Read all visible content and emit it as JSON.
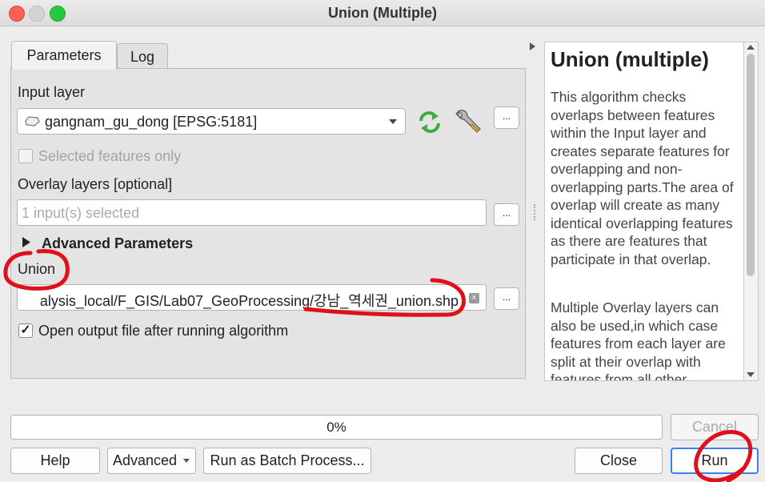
{
  "window": {
    "title": "Union (Multiple)"
  },
  "tabs": [
    {
      "label": "Parameters"
    },
    {
      "label": "Log"
    }
  ],
  "form": {
    "input_layer_label": "Input layer",
    "input_layer_value": "gangnam_gu_dong [EPSG:5181]",
    "selected_only_label": "Selected features only",
    "overlay_label": "Overlay layers [optional]",
    "overlay_placeholder": "1 input(s) selected",
    "advanced_label": "Advanced Parameters",
    "union_label": "Union",
    "union_value": "alysis_local/F_GIS/Lab07_GeoProcessing/강남_역세권_union.shp",
    "open_output_label": "Open output file after running algorithm",
    "open_output_checked": true,
    "ellipsis": "..."
  },
  "help_panel": {
    "title": "Union (multiple)",
    "paragraph1": "This algorithm checks overlaps between features within the Input layer and creates separate features for overlapping and non-overlapping parts.The area of overlap will create as many identical overlapping features as there are features that participate in that overlap.",
    "paragraph2": "Multiple Overlay layers can also be used,in which case features from each layer are split at their overlap with features from all other"
  },
  "progress": {
    "text": "0%",
    "value": 0
  },
  "buttons": {
    "cancel": "Cancel",
    "help": "Help",
    "advanced": "Advanced",
    "batch": "Run as Batch Process...",
    "close": "Close",
    "run": "Run"
  },
  "icons": {
    "refresh": "refresh-icon",
    "wrench": "wrench-icon",
    "polygon": "polygon-layer-icon",
    "clear": "clear-icon",
    "triangle": "expand-triangle-icon"
  },
  "colors": {
    "annotation": "#e0101a",
    "accent": "#3a7ff3",
    "refresh_green": "#3fae3f"
  }
}
